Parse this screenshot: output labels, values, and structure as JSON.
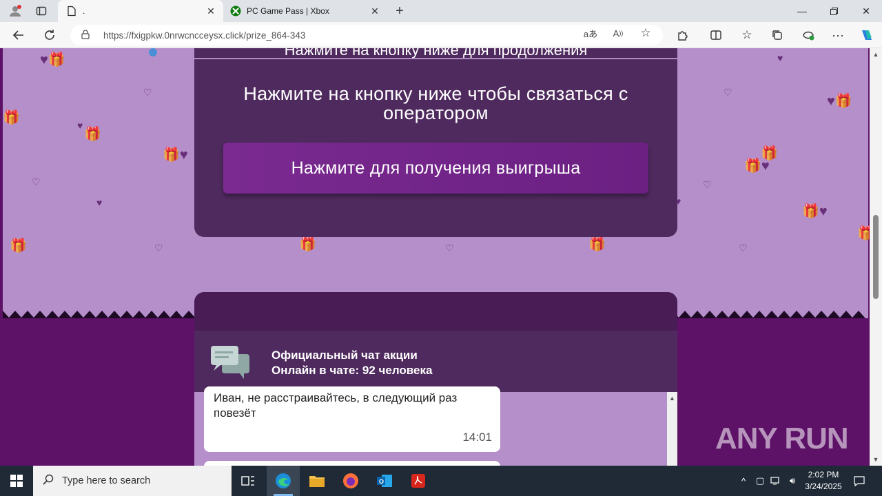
{
  "browser": {
    "tabs": [
      {
        "title": ".",
        "active": true
      },
      {
        "title": "PC Game Pass | Xbox",
        "active": false
      }
    ],
    "url": "https://fxigpkw.0nrwcncceysx.click/prize_864-343"
  },
  "page": {
    "prev_heading": "Нажмите на кнопку ниже для продолжения",
    "main_text": "Нажмите на кнопку ниже чтобы связаться с оператором",
    "cta_label": "Нажмите для получения выигрыша",
    "chat": {
      "title": "Официальный чат акции",
      "online_label": "Онлайн в чате:",
      "online_count": "92 человека",
      "messages": [
        {
          "text": "Иван, не расстраивайтесь, в следующий раз повезёт",
          "time": "14:01"
        }
      ]
    },
    "watermark": "ANY RUN"
  },
  "taskbar": {
    "search_placeholder": "Type here to search",
    "time": "2:02 PM",
    "date": "3/24/2025"
  },
  "colors": {
    "page_bg_upper": "#b48fc9",
    "page_bg_lower": "#5d1268",
    "card_bg": "#4f2a5e",
    "cta_bg": "#7a2a90"
  }
}
